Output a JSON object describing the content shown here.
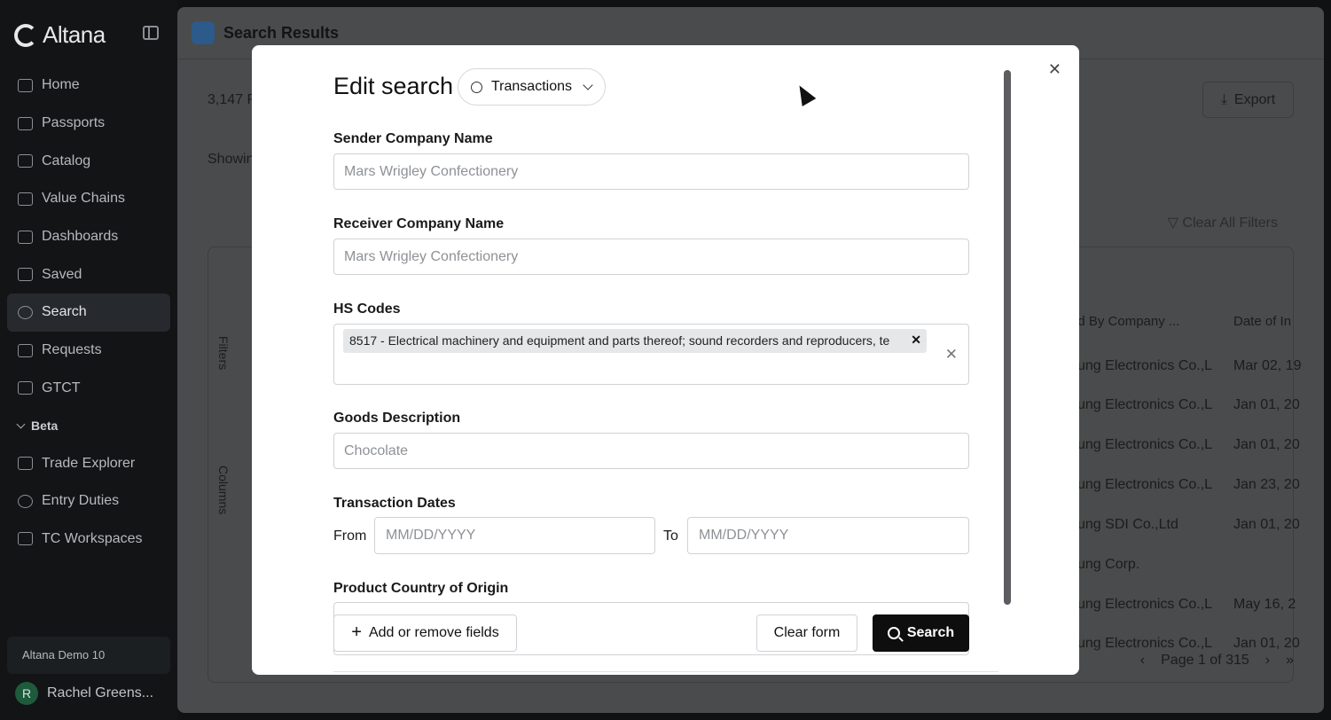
{
  "sidebar": {
    "brand": "Altana",
    "items": [
      {
        "label": "Home",
        "icon": "home-icon"
      },
      {
        "label": "Passports",
        "icon": "passport-icon"
      },
      {
        "label": "Catalog",
        "icon": "catalog-icon"
      },
      {
        "label": "Value Chains",
        "icon": "value-chains-icon"
      },
      {
        "label": "Dashboards",
        "icon": "dashboards-icon"
      },
      {
        "label": "Saved",
        "icon": "folder-icon"
      },
      {
        "label": "Search",
        "icon": "search-icon",
        "active": true
      },
      {
        "label": "Requests",
        "icon": "requests-icon"
      },
      {
        "label": "GTCT",
        "icon": "chart-icon"
      }
    ],
    "beta_label": "Beta",
    "beta_items": [
      {
        "label": "Trade Explorer",
        "icon": "trade-explorer-icon"
      },
      {
        "label": "Entry Duties",
        "icon": "dollar-icon"
      },
      {
        "label": "TC Workspaces",
        "icon": "grid-icon"
      }
    ],
    "org": "Altana Demo 10",
    "user_initial": "R",
    "user_name": "Rachel Greens..."
  },
  "main": {
    "title": "Search Results",
    "results_count": "3,147 R",
    "export_label": "Export",
    "showing": "Showin",
    "clear_filters": "Clear All Filters",
    "filters_tab": "Filters",
    "columns_tab": "Columns",
    "col_company": "ed By Company ...",
    "col_date": "Date of In",
    "rows": [
      {
        "company": "sung Electronics Co.,L",
        "date": "Mar 02, 19"
      },
      {
        "company": "sung Electronics Co.,L",
        "date": "Jan 01, 20"
      },
      {
        "company": "sung Electronics Co.,L",
        "date": "Jan 01, 20"
      },
      {
        "company": "sung Electronics Co.,L",
        "date": "Jan 23, 20"
      },
      {
        "company": "sung SDI Co.,Ltd",
        "date": "Jan 01, 20"
      },
      {
        "company": "sung Corp.",
        "date": ""
      },
      {
        "company": "sung Electronics Co.,L",
        "date": "May 16, 2"
      },
      {
        "company": "sung Electronics Co.,L",
        "date": "Jan 01, 20"
      }
    ],
    "page_label": "Page 1 of 315"
  },
  "modal": {
    "title": "Edit search",
    "type_label": "Transactions",
    "fields": {
      "sender_label": "Sender Company Name",
      "sender_placeholder": "Mars Wrigley Confectionery",
      "receiver_label": "Receiver Company Name",
      "receiver_placeholder": "Mars Wrigley Confectionery",
      "hs_label": "HS Codes",
      "hs_tag": "8517 - Electrical machinery and equipment and parts thereof; sound recorders and reproducers, te",
      "goods_label": "Goods Description",
      "goods_placeholder": "Chocolate",
      "dates_label": "Transaction Dates",
      "from_label": "From",
      "to_label": "To",
      "date_placeholder": "MM/DD/YYYY",
      "origin_label": "Product Country of Origin"
    },
    "add_fields_label": "Add or remove fields",
    "clear_label": "Clear form",
    "search_label": "Search"
  }
}
